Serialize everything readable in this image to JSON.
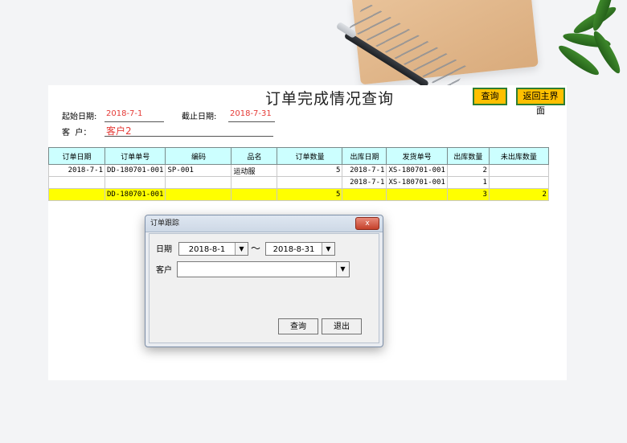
{
  "report": {
    "title": "订单完成情况查询",
    "query_button": "查询",
    "home_button": "返回主界面",
    "start_label": "起始日期:",
    "start_value": "2018-7-1",
    "end_label": "截止日期:",
    "end_value": "2018-7-31",
    "customer_label": "客  户：",
    "customer_value": "客户2"
  },
  "table": {
    "headers": [
      "订单日期",
      "订单单号",
      "编码",
      "品名",
      "订单数量",
      "出库日期",
      "发货单号",
      "出库数量",
      "未出库数量"
    ],
    "rows": [
      [
        "2018-7-1",
        "DD-180701-001",
        "SP-001",
        "运动服",
        "5",
        "2018-7-1",
        "XS-180701-001",
        "2",
        ""
      ],
      [
        "",
        "",
        "",
        "",
        "",
        "2018-7-1",
        "XS-180701-001",
        "1",
        ""
      ]
    ],
    "total": [
      "",
      "DD-180701-001",
      "",
      "",
      "5",
      "",
      "",
      "3",
      "2"
    ]
  },
  "dialog": {
    "title": "订单跟踪",
    "close": "x",
    "date_label": "日期",
    "date_from": "2018-8-1",
    "tilde": "～",
    "date_to": "2018-8-31",
    "customer_label": "客户",
    "customer_value": "",
    "query_button": "查询",
    "exit_button": "退出"
  },
  "colors": {
    "accent_yellow": "#ffc000",
    "header_cyan": "#ccffff",
    "total_row": "#ffff00",
    "value_red": "#e53935"
  }
}
